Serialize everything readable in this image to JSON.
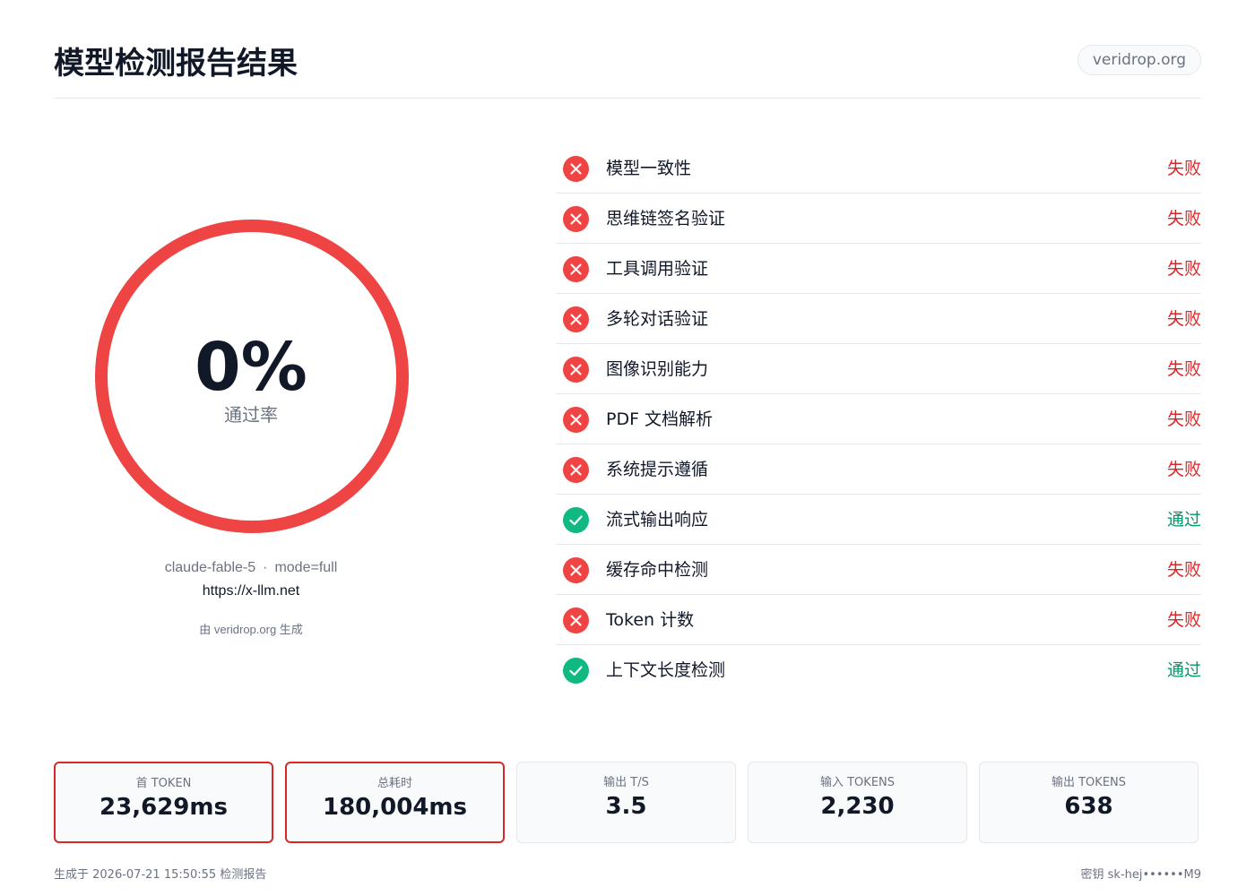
{
  "header": {
    "title": "模型检测报告结果",
    "domain_badge": "veridrop.org"
  },
  "score": {
    "value": "0%",
    "label": "通过率",
    "fraction": 0,
    "ring_color": "#ef4444",
    "model": "claude-fable-5",
    "separator": "·",
    "mode": "mode=full",
    "endpoint": "https://x-llm.net",
    "credit": "由 veridrop.org 生成"
  },
  "checks": [
    {
      "name": "模型一致性",
      "result": "失败",
      "status": "fail",
      "icon": "x-circle-icon"
    },
    {
      "name": "思维链签名验证",
      "result": "失败",
      "status": "fail",
      "icon": "x-circle-icon"
    },
    {
      "name": "工具调用验证",
      "result": "失败",
      "status": "fail",
      "icon": "x-circle-icon"
    },
    {
      "name": "多轮对话验证",
      "result": "失败",
      "status": "fail",
      "icon": "x-circle-icon"
    },
    {
      "name": "图像识别能力",
      "result": "失败",
      "status": "fail",
      "icon": "x-circle-icon"
    },
    {
      "name": "PDF 文档解析",
      "result": "失败",
      "status": "fail",
      "icon": "x-circle-icon"
    },
    {
      "name": "系统提示遵循",
      "result": "失败",
      "status": "fail",
      "icon": "x-circle-icon"
    },
    {
      "name": "流式输出响应",
      "result": "通过",
      "status": "pass",
      "icon": "check-circle-icon"
    },
    {
      "name": "缓存命中检测",
      "result": "失败",
      "status": "fail",
      "icon": "x-circle-icon"
    },
    {
      "name": "Token 计数",
      "result": "失败",
      "status": "fail",
      "icon": "x-circle-icon"
    },
    {
      "name": "上下文长度检测",
      "result": "通过",
      "status": "pass",
      "icon": "check-circle-icon"
    }
  ],
  "stats": [
    {
      "label": "首 TOKEN",
      "value": "23,629ms",
      "alert": true
    },
    {
      "label": "总耗时",
      "value": "180,004ms",
      "alert": true
    },
    {
      "label": "输出 T/S",
      "value": "3.5",
      "alert": false
    },
    {
      "label": "输入 TOKENS",
      "value": "2,230",
      "alert": false
    },
    {
      "label": "输出 TOKENS",
      "value": "638",
      "alert": false
    }
  ],
  "footer": {
    "left": "生成于 2026-07-21 15:50:55 检测报告",
    "right": "密钥 sk-hej••••••M9"
  },
  "colors": {
    "fail": "#ef4444",
    "pass": "#10b981",
    "alert_border": "#dc2626"
  }
}
